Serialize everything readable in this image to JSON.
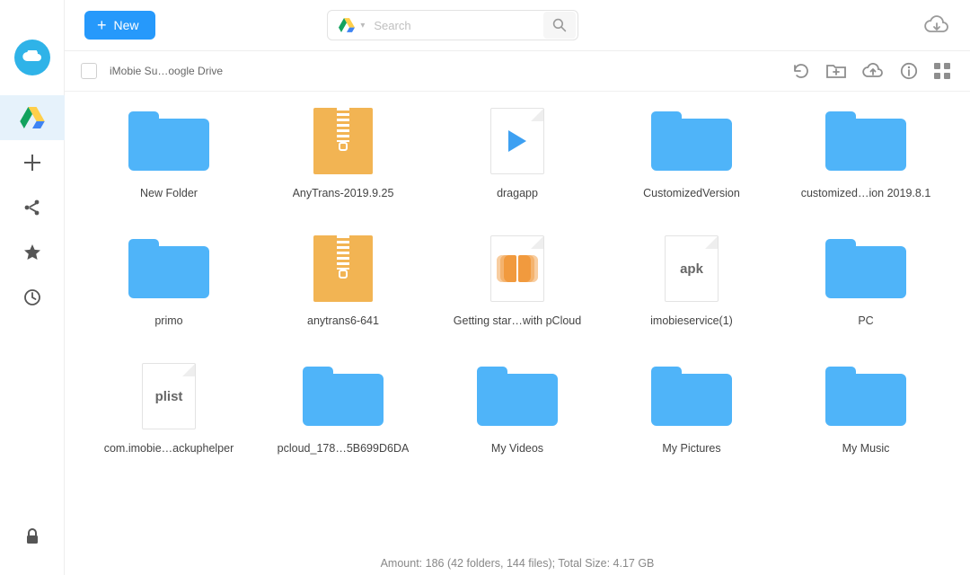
{
  "window": {
    "traffic": true
  },
  "topbar": {
    "new_label": "New",
    "search_placeholder": "Search"
  },
  "subbar": {
    "breadcrumb": "iMobie Su…oogle Drive"
  },
  "files": [
    {
      "kind": "folder",
      "label": "New Folder"
    },
    {
      "kind": "zip",
      "label": "AnyTrans-2019.9.25"
    },
    {
      "kind": "video",
      "label": "dragapp"
    },
    {
      "kind": "folder",
      "label": "CustomizedVersion"
    },
    {
      "kind": "folder",
      "label": "customized…ion 2019.8.1"
    },
    {
      "kind": "folder",
      "label": "primo"
    },
    {
      "kind": "zip",
      "label": "anytrans6-641"
    },
    {
      "kind": "book",
      "label": "Getting star…with pCloud"
    },
    {
      "kind": "apk",
      "label": "imobieservice(1)"
    },
    {
      "kind": "folder",
      "label": "PC"
    },
    {
      "kind": "plist",
      "label": "com.imobie…ackuphelper"
    },
    {
      "kind": "folder",
      "label": "pcloud_178…5B699D6DA"
    },
    {
      "kind": "folder",
      "label": "My Videos"
    },
    {
      "kind": "folder",
      "label": "My Pictures"
    },
    {
      "kind": "folder",
      "label": "My Music"
    }
  ],
  "status": {
    "text": "Amount: 186 (42 folders, 144 files); Total Size:  4.17 GB"
  }
}
